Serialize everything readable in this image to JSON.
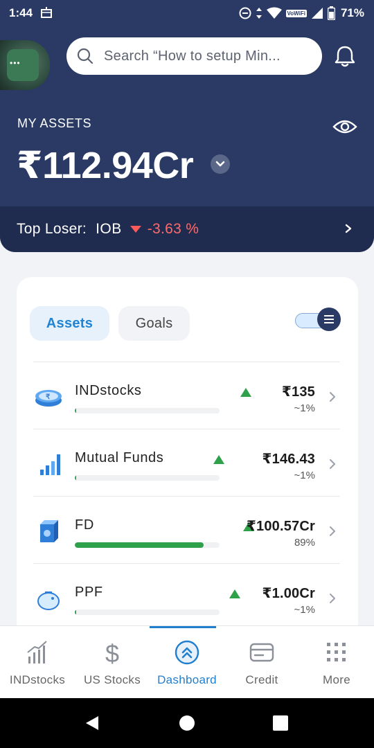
{
  "status_bar": {
    "time": "1:44",
    "vowifi": "VoWiFi",
    "battery": "71%"
  },
  "search": {
    "placeholder": "Search “How to setup Min..."
  },
  "assets_summary": {
    "label": "MY ASSETS",
    "total": "₹112.94Cr"
  },
  "top_loser": {
    "label": "Top Loser:",
    "name": "IOB",
    "change": "-3.63 %"
  },
  "tabs": {
    "assets": "Assets",
    "goals": "Goals"
  },
  "asset_rows": [
    {
      "name": "INDstocks",
      "value": "₹135",
      "pct": "~1%",
      "fill": 0.01
    },
    {
      "name": "Mutual Funds",
      "value": "₹146.43",
      "pct": "~1%",
      "fill": 0.01
    },
    {
      "name": "FD",
      "value": "₹100.57Cr",
      "pct": "89%",
      "fill": 0.89
    },
    {
      "name": "PPF",
      "value": "₹1.00Cr",
      "pct": "~1%",
      "fill": 0.01
    }
  ],
  "bottom_nav": {
    "items": [
      {
        "label": "INDstocks",
        "icon": "chart-bars-icon"
      },
      {
        "label": "US Stocks",
        "icon": "dollar-icon"
      },
      {
        "label": "Dashboard",
        "icon": "dashboard-chevrons-icon",
        "active": true
      },
      {
        "label": "Credit",
        "icon": "credit-card-icon"
      },
      {
        "label": "More",
        "icon": "grid-dots-icon"
      }
    ]
  },
  "colors": {
    "header_bg": "#2a3a64",
    "loser_bar_bg": "#1f2c4f",
    "accent_blue": "#1f7fce",
    "up_green": "#2fa14a",
    "down_red": "#ff5a5a"
  }
}
